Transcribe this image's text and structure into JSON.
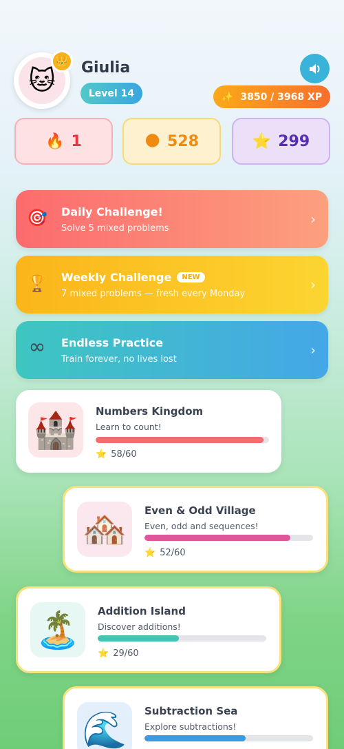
{
  "profile": {
    "name": "Giulia",
    "level": "Level 14",
    "avatar_icon": "cat-face-icon",
    "crown_icon": "crown-icon"
  },
  "xp": {
    "label": "3850 / 3968 XP",
    "icon": "sparkle-icon"
  },
  "stats": {
    "fire": "1",
    "coins": "528",
    "stars": "299"
  },
  "challenges": [
    {
      "title": "Daily Challenge!",
      "subtitle": "Solve 5 mixed problems",
      "icon": "target-icon"
    },
    {
      "title": "Weekly Challenge",
      "badge": "NEW",
      "subtitle": "7 mixed problems — fresh every Monday",
      "icon": "trophy-icon"
    },
    {
      "title": "Endless Practice",
      "subtitle": "Train forever, no lives lost",
      "icon": "infinity-icon"
    }
  ],
  "levels": [
    {
      "name": "Numbers Kingdom",
      "desc": "Learn to count!",
      "score": "58/60",
      "progress": 0.967,
      "color": "#f26d6d",
      "icon": "castle-icon"
    },
    {
      "name": "Even & Odd Village",
      "desc": "Even, odd and sequences!",
      "score": "52/60",
      "progress": 0.867,
      "color": "#e0569a",
      "icon": "houses-icon"
    },
    {
      "name": "Addition Island",
      "desc": "Discover additions!",
      "score": "29/60",
      "progress": 0.483,
      "color": "#45c4b4",
      "icon": "island-icon"
    },
    {
      "name": "Subtraction Sea",
      "desc": "Explore subtractions!",
      "score": "",
      "progress": 0.6,
      "color": "#3a9be3",
      "icon": "wave-icon"
    }
  ]
}
